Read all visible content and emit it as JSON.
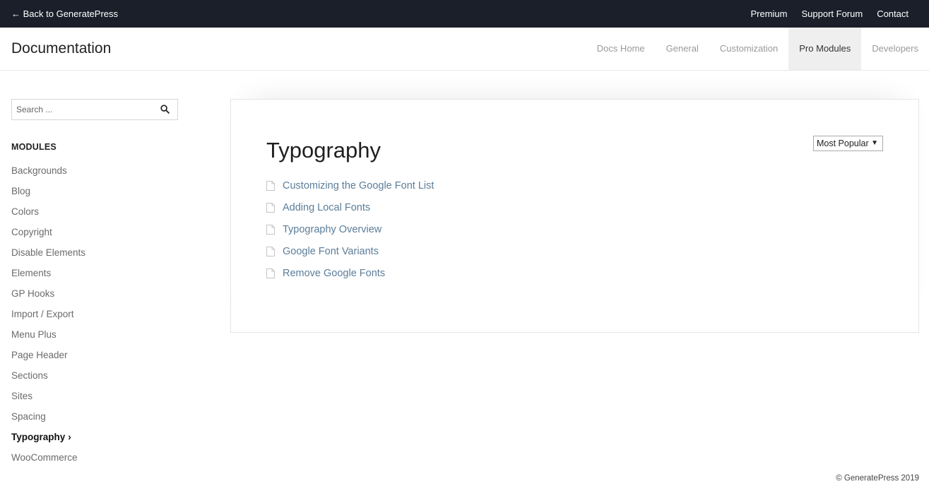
{
  "topbar": {
    "back_label": "← Back to GeneratePress",
    "links": [
      "Premium",
      "Support Forum",
      "Contact"
    ]
  },
  "header": {
    "site_title": "Documentation",
    "nav": [
      "Docs Home",
      "General",
      "Customization",
      "Pro Modules",
      "Developers"
    ],
    "active_nav": "Pro Modules"
  },
  "sidebar": {
    "search_placeholder": "Search ...",
    "modules_heading": "MODULES",
    "modules": [
      "Backgrounds",
      "Blog",
      "Colors",
      "Copyright",
      "Disable Elements",
      "Elements",
      "GP Hooks",
      "Import / Export",
      "Menu Plus",
      "Page Header",
      "Sections",
      "Sites",
      "Spacing",
      "Typography",
      "WooCommerce"
    ],
    "current_module": "Typography",
    "current_marker": "›"
  },
  "main": {
    "title": "Typography",
    "sort_value": "Most Popular",
    "sort_arrow": "▼",
    "articles": [
      "Customizing the Google Font List",
      "Adding Local Fonts",
      "Typography Overview",
      "Google Font Variants",
      "Remove Google Fonts"
    ]
  },
  "footer": {
    "copyright": "© GeneratePress 2019"
  },
  "colors": {
    "topbar_bg": "#1b1f2a",
    "link": "#5b7d99",
    "active_nav_bg": "#efefef"
  }
}
